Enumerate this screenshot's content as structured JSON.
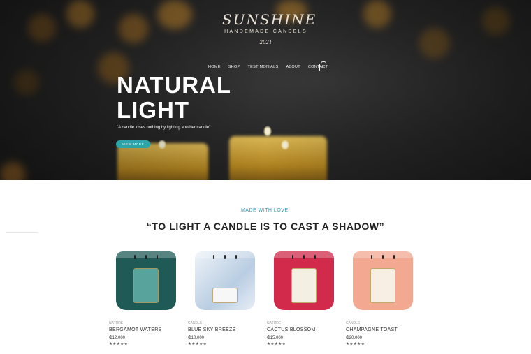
{
  "hero": {
    "logo_script": "SUNSHINE",
    "logo_subtitle": "HANDEMADE CANDELS",
    "logo_year": "2021",
    "title_line1": "NATURAL",
    "title_line2": "LIGHT",
    "quote": "\"A candle loses nothing by lighting another candle\"",
    "button_label": "VIEW MORE"
  },
  "nav": {
    "items": [
      {
        "label": "HOME"
      },
      {
        "label": "SHOP"
      },
      {
        "label": "TESTIMONIALS"
      },
      {
        "label": "ABOUT"
      },
      {
        "label": "CONTACT"
      }
    ],
    "cart_count": "0"
  },
  "intro": {
    "kicker": "MADE WITH LOVE!",
    "title": "“TO LIGHT A CANDLE IS TO CAST A SHADOW”"
  },
  "products": [
    {
      "category": "NATURE",
      "name": "BERGAMOT WATERS",
      "price": "₲12,000",
      "stars": "★★★★★",
      "color": "#1f5a57",
      "label_color": "#58a39c"
    },
    {
      "category": "CANDLE",
      "name": "BLUE SKY BREEZE",
      "price": "₲10,000",
      "stars": "★★★★★",
      "color": "#dfe8f2",
      "label_color": "#f7f7f7"
    },
    {
      "category": "NATURE",
      "name": "CACTUS BLOSSOM",
      "price": "₲15,000",
      "stars": "★★★★★",
      "color": "#d12a4b",
      "label_color": "#f4efe3"
    },
    {
      "category": "CANDLE",
      "name": "CHAMPAGNE TOAST",
      "price": "₲20,000",
      "stars": "★★★★★",
      "color": "#f2a891",
      "label_color": "#f8efe4"
    }
  ],
  "colors": {
    "accent": "#2ea3a8",
    "kicker": "#3a9ab8"
  }
}
